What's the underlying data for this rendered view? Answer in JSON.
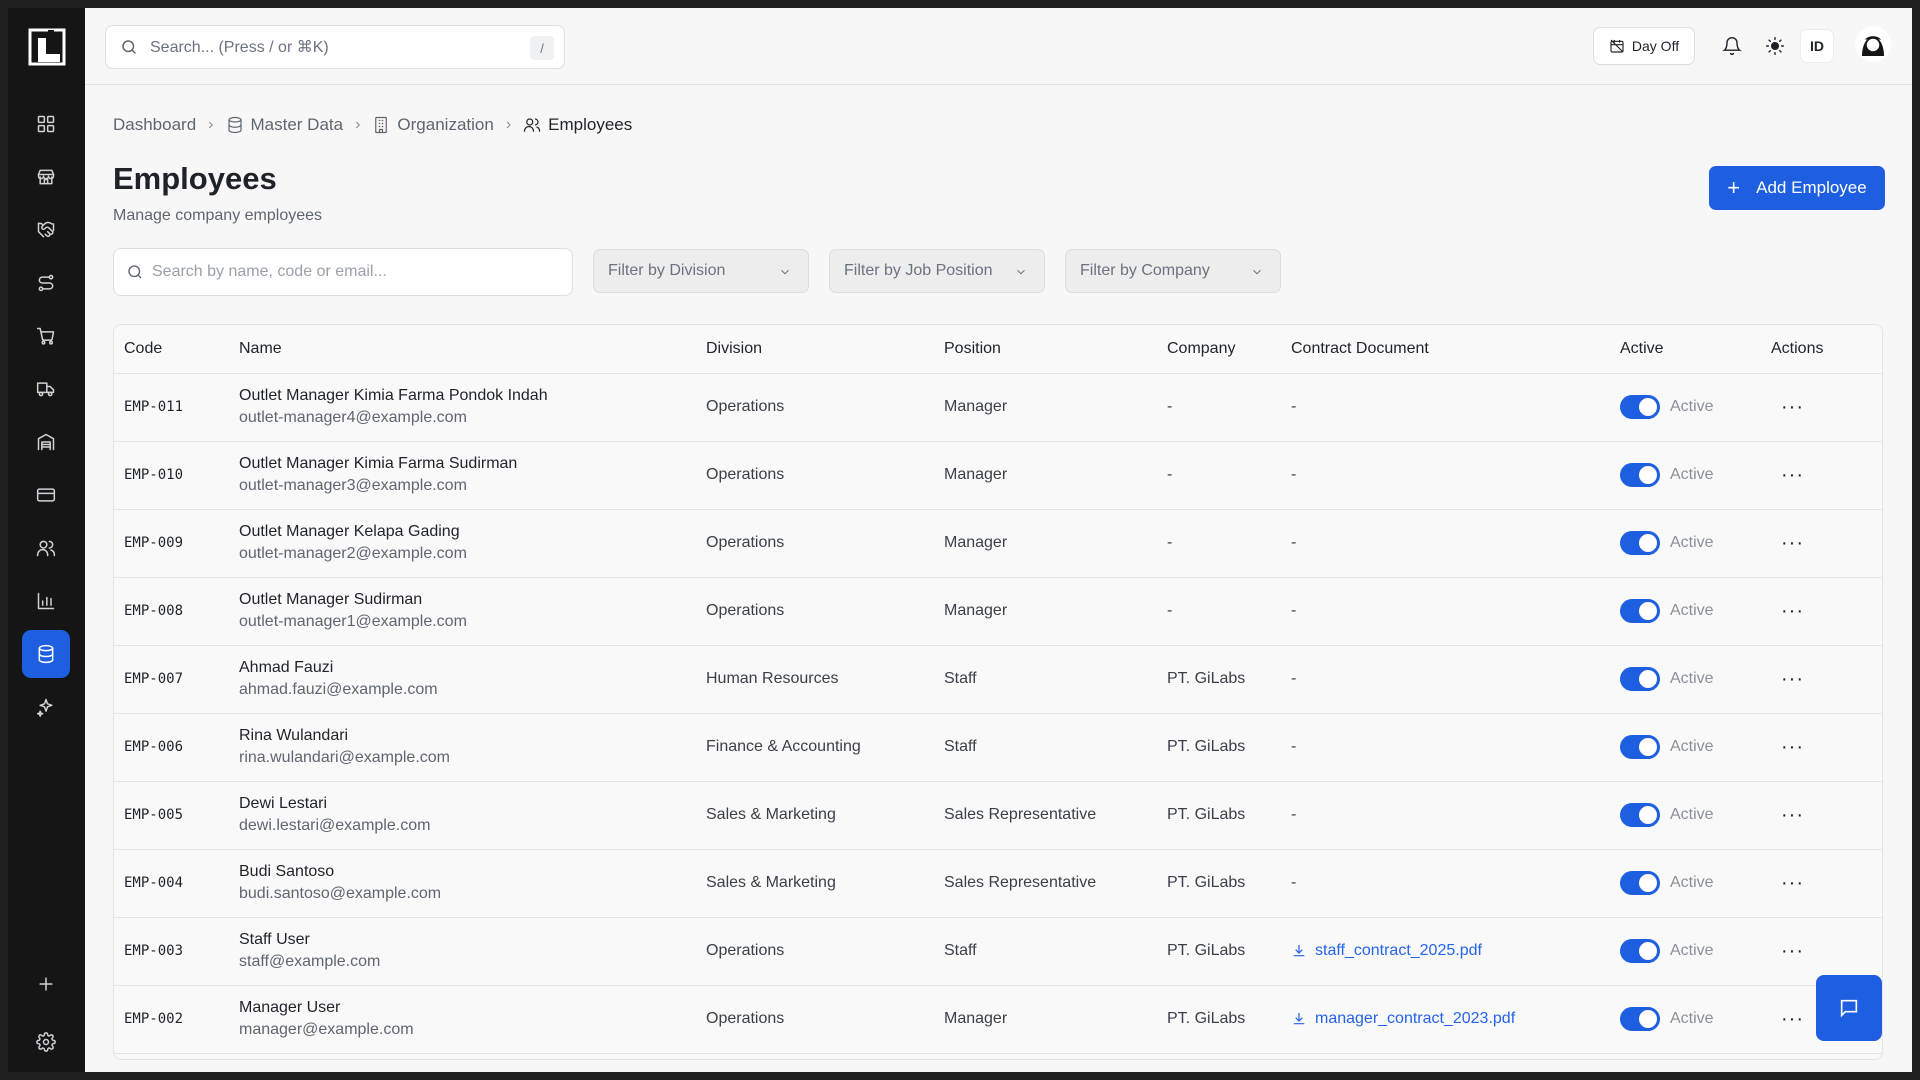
{
  "topbar": {
    "search_placeholder": "Search... (Press / or ⌘K)",
    "search_shortcut": "/",
    "dayoff_label": "Day Off",
    "language": "ID"
  },
  "breadcrumb": {
    "items": [
      "Dashboard",
      "Master Data",
      "Organization",
      "Employees"
    ]
  },
  "page": {
    "title": "Employees",
    "subtitle": "Manage company employees",
    "add_button": "Add Employee"
  },
  "filters": {
    "search_placeholder": "Search by name, code or email...",
    "division": "Filter by Division",
    "position": "Filter by Job Position",
    "company": "Filter by Company"
  },
  "table": {
    "headers": [
      "Code",
      "Name",
      "Division",
      "Position",
      "Company",
      "Contract Document",
      "Active",
      "Actions"
    ],
    "rows": [
      {
        "code": "EMP-011",
        "name": "Outlet Manager Kimia Farma Pondok Indah",
        "email": "outlet-manager4@example.com",
        "division": "Operations",
        "position": "Manager",
        "company": "-",
        "document": "-",
        "active": "Active"
      },
      {
        "code": "EMP-010",
        "name": "Outlet Manager Kimia Farma Sudirman",
        "email": "outlet-manager3@example.com",
        "division": "Operations",
        "position": "Manager",
        "company": "-",
        "document": "-",
        "active": "Active"
      },
      {
        "code": "EMP-009",
        "name": "Outlet Manager Kelapa Gading",
        "email": "outlet-manager2@example.com",
        "division": "Operations",
        "position": "Manager",
        "company": "-",
        "document": "-",
        "active": "Active"
      },
      {
        "code": "EMP-008",
        "name": "Outlet Manager Sudirman",
        "email": "outlet-manager1@example.com",
        "division": "Operations",
        "position": "Manager",
        "company": "-",
        "document": "-",
        "active": "Active"
      },
      {
        "code": "EMP-007",
        "name": "Ahmad Fauzi",
        "email": "ahmad.fauzi@example.com",
        "division": "Human Resources",
        "position": "Staff",
        "company": "PT. GiLabs",
        "document": "-",
        "active": "Active"
      },
      {
        "code": "EMP-006",
        "name": "Rina Wulandari",
        "email": "rina.wulandari@example.com",
        "division": "Finance & Accounting",
        "position": "Staff",
        "company": "PT. GiLabs",
        "document": "-",
        "active": "Active"
      },
      {
        "code": "EMP-005",
        "name": "Dewi Lestari",
        "email": "dewi.lestari@example.com",
        "division": "Sales & Marketing",
        "position": "Sales Representative",
        "company": "PT. GiLabs",
        "document": "-",
        "active": "Active"
      },
      {
        "code": "EMP-004",
        "name": "Budi Santoso",
        "email": "budi.santoso@example.com",
        "division": "Sales & Marketing",
        "position": "Sales Representative",
        "company": "PT. GiLabs",
        "document": "-",
        "active": "Active"
      },
      {
        "code": "EMP-003",
        "name": "Staff User",
        "email": "staff@example.com",
        "division": "Operations",
        "position": "Staff",
        "company": "PT. GiLabs",
        "document": "staff_contract_2025.pdf",
        "active": "Active"
      },
      {
        "code": "EMP-002",
        "name": "Manager User",
        "email": "manager@example.com",
        "division": "Operations",
        "position": "Manager",
        "company": "PT. GiLabs",
        "document": "manager_contract_2023.pdf",
        "active": "Active"
      }
    ]
  },
  "colors": {
    "accent": "#1d5fe0",
    "link": "#2563eb",
    "sidebar_bg": "#151515"
  },
  "icons": {
    "sidebar": [
      "dashboard-icon",
      "store-icon",
      "handshake-icon",
      "route-icon",
      "cart-icon",
      "truck-icon",
      "warehouse-icon",
      "card-icon",
      "users-icon",
      "chart-icon",
      "database-icon",
      "sparkle-icon",
      "plus-icon",
      "gear-icon"
    ]
  }
}
